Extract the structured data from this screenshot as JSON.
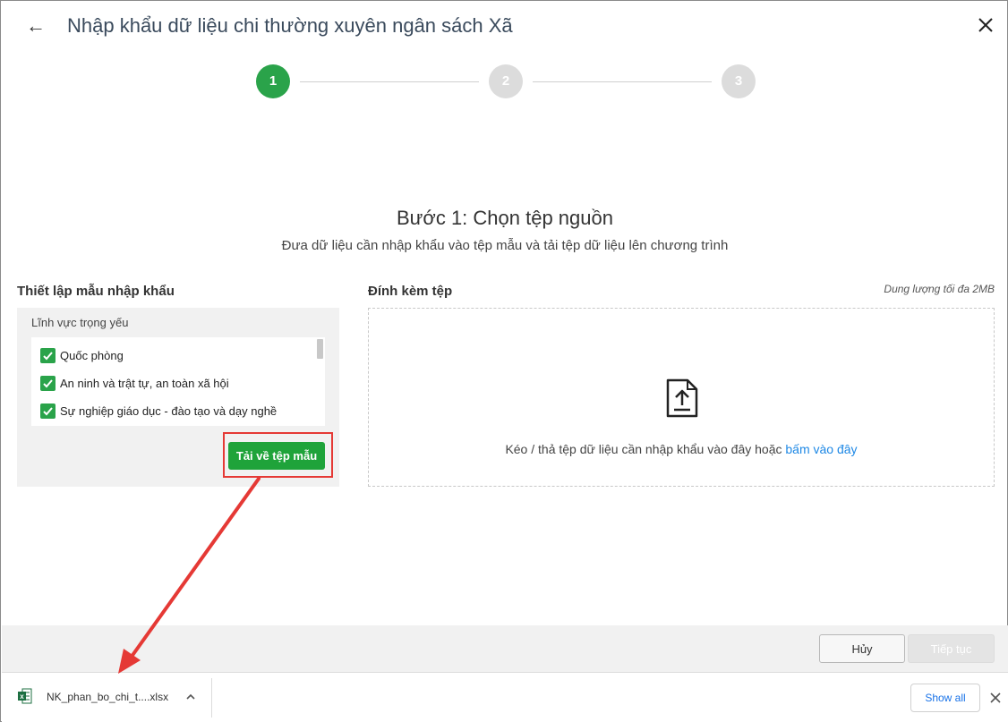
{
  "header": {
    "title": "Nhập khẩu dữ liệu chi thường xuyên ngân sách Xã",
    "back_icon": "arrow-left-icon",
    "close_icon": "close-icon"
  },
  "stepper": {
    "steps": [
      "1",
      "2",
      "3"
    ],
    "active_step": 1
  },
  "step_heading": {
    "title": "Bước 1: Chọn tệp nguồn",
    "subtitle": "Đưa dữ liệu cần nhập khẩu vào tệp mẫu và tải tệp dữ liệu lên chương trình"
  },
  "template_setup": {
    "title": "Thiết lập mẫu nhập khẩu",
    "field_label": "Lĩnh vực trọng yếu",
    "items": [
      {
        "label": "Quốc phòng",
        "checked": true
      },
      {
        "label": "An ninh và trật tự, an toàn xã hội",
        "checked": true
      },
      {
        "label": "Sự nghiệp giáo dục - đào tạo và dạy nghề",
        "checked": true
      }
    ],
    "download_button": "Tải về tệp mẫu"
  },
  "attachment": {
    "title": "Đính kèm tệp",
    "size_hint": "Dung lượng tối đa 2MB",
    "drop_text": "Kéo / thả tệp dữ liệu cần nhập khẩu vào đây hoặc",
    "drop_link": "bấm vào đây",
    "icon": "file-upload-icon"
  },
  "footer": {
    "cancel": "Hủy",
    "next": "Tiếp tục"
  },
  "download_bar": {
    "file_name": "NK_phan_bo_chi_t....xlsx",
    "show_all": "Show all"
  },
  "colors": {
    "accent_green": "#2aa34a",
    "button_green": "#1fa33a",
    "link_blue": "#1e88e5",
    "annotation_red": "#e53935"
  }
}
